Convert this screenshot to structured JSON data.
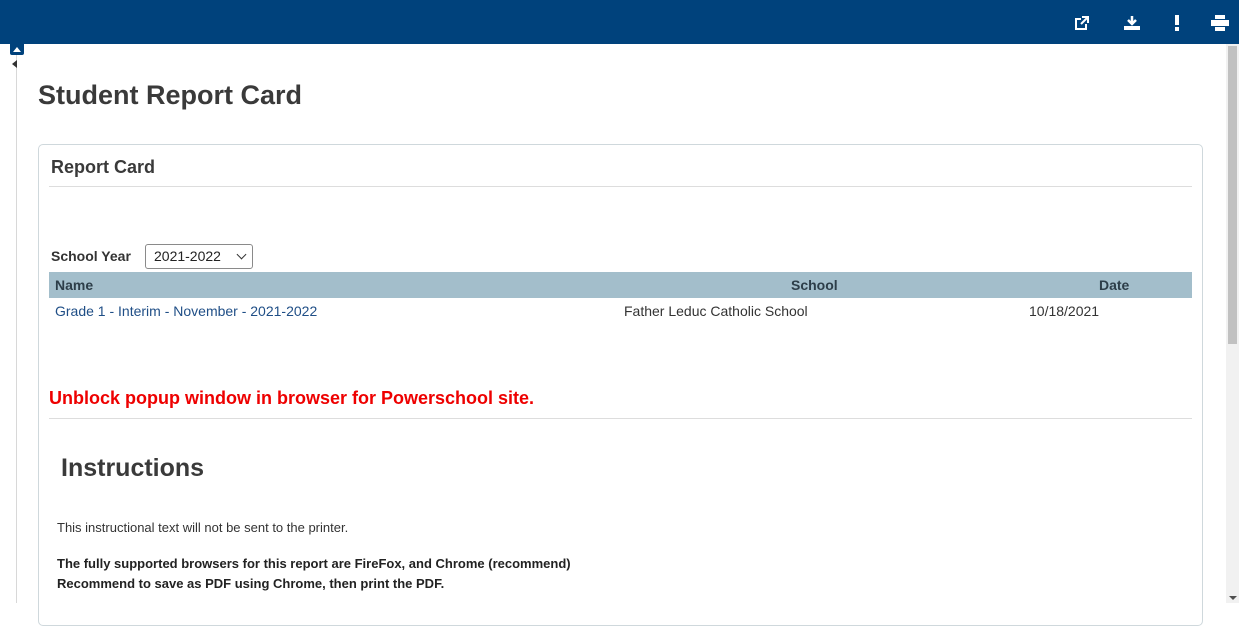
{
  "toolbar": {
    "icons": [
      "open-new-window-icon",
      "download-icon",
      "exclamation-icon",
      "print-icon"
    ]
  },
  "page": {
    "title": "Student Report Card"
  },
  "report_box": {
    "title": "Report Card",
    "school_year_label": "School Year",
    "school_year_value": "2021-2022"
  },
  "table": {
    "headers": {
      "name": "Name",
      "school": "School",
      "date": "Date"
    },
    "rows": [
      {
        "name": "Grade 1 - Interim - November - 2021-2022",
        "school": "Father Leduc Catholic School",
        "date": "10/18/2021"
      }
    ]
  },
  "alert": {
    "text": "Unblock popup window in browser for Powerschool site.",
    "color": "#ee0000"
  },
  "instructions": {
    "title": "Instructions",
    "note": "This instructional text will not be sent to the printer.",
    "line1": "The fully supported browsers for this report are FireFox, and Chrome (recommend)",
    "line2": "Recommend to save as PDF using Chrome, then print the PDF."
  },
  "colors": {
    "header_bar": "#00427c",
    "table_header": "#a3becb",
    "link": "#1f4e86"
  }
}
